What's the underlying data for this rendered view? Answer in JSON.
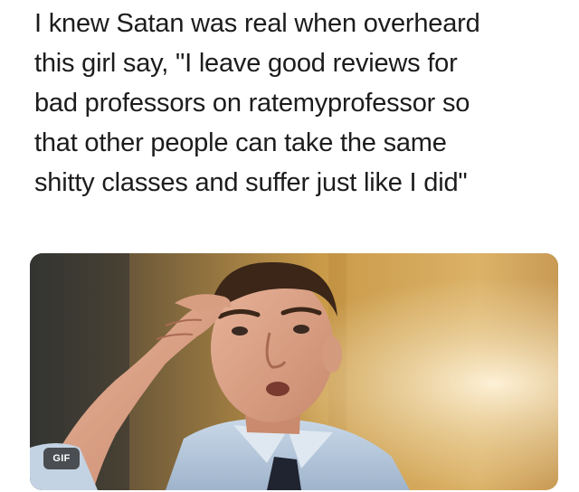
{
  "post": {
    "caption_lines": [
      "I knew Satan was real when overheard",
      "this girl say, \"I leave good reviews for",
      "bad professors on ratemyprofessor so",
      "that other people can take the same",
      "shitty classes and suffer just like I did\""
    ],
    "media": {
      "badge_label": "GIF",
      "badge_icon": "gif-badge"
    }
  },
  "colors": {
    "text": "#1c1c1c",
    "background": "#ffffff",
    "badge_bg": "#2a2a2a",
    "warm_background": "#d9a94e",
    "shirt": "#b7cbe0"
  }
}
